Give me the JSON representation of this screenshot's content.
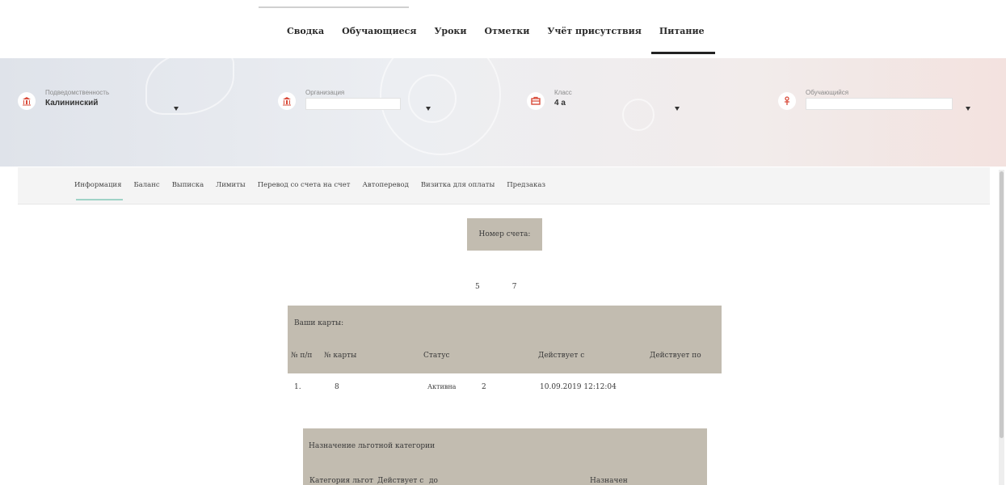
{
  "top_nav": {
    "tabs": [
      {
        "label": "Сводка",
        "active": false
      },
      {
        "label": "Обучающиеся",
        "active": false
      },
      {
        "label": "Уроки",
        "active": false
      },
      {
        "label": "Отметки",
        "active": false
      },
      {
        "label": "Учёт присутствия",
        "active": false
      },
      {
        "label": "Питание",
        "active": true
      }
    ]
  },
  "filters": {
    "subordination": {
      "label": "Подведомственность",
      "value": "Калининский",
      "icon": "building-icon"
    },
    "organization": {
      "label": "Организация",
      "value": "",
      "icon": "building-icon"
    },
    "class": {
      "label": "Класс",
      "value": "4 а",
      "icon": "classroom-icon"
    },
    "student": {
      "label": "Обучающийся",
      "value": "",
      "icon": "student-icon"
    }
  },
  "sub_nav": {
    "items": [
      {
        "label": "Информация",
        "active": true
      },
      {
        "label": "Баланс",
        "active": false
      },
      {
        "label": "Выписка",
        "active": false
      },
      {
        "label": "Лимиты",
        "active": false
      },
      {
        "label": "Перевод со счета на счет",
        "active": false
      },
      {
        "label": "Автоперевод",
        "active": false
      },
      {
        "label": "Визитка для оплаты",
        "active": false
      },
      {
        "label": "Предзаказ",
        "active": false
      }
    ]
  },
  "account": {
    "header": "Номер счета:",
    "values": [
      "5",
      "7"
    ]
  },
  "cards": {
    "title": "Ваши карты:",
    "columns": [
      "№ п/п",
      "№ карты",
      "Статус",
      "Действует с",
      "Действует по"
    ],
    "rows": [
      {
        "num": "1.",
        "card": "8",
        "status": "Активна",
        "status_extra": "2",
        "from": "10.09.2019 12:12:04",
        "to": ""
      }
    ]
  },
  "benefit": {
    "title": "Назначение льготной категории",
    "columns": [
      "Категория льгот",
      "Действует с",
      "до",
      "Назначен"
    ]
  },
  "colors": {
    "table_header_bg": "#c2bcb0",
    "accent_red": "#d94b3a",
    "active_tab_underline": "#222222",
    "active_subtab_underline": "#9fd3c7"
  }
}
